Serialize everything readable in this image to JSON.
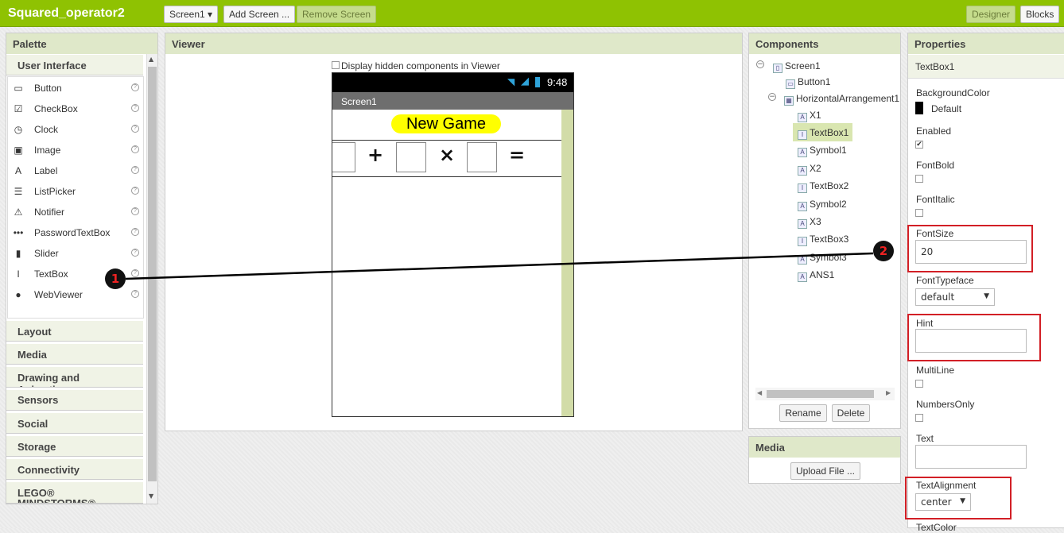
{
  "app": {
    "title": "Squared_operator2"
  },
  "toolbar": {
    "screen_select": "Screen1 ▾",
    "add_screen": "Add Screen ...",
    "remove_screen": "Remove Screen",
    "designer": "Designer",
    "blocks": "Blocks"
  },
  "palette": {
    "title": "Palette",
    "category": "User Interface",
    "items": [
      {
        "label": "Button",
        "icon": "button-icon"
      },
      {
        "label": "CheckBox",
        "icon": "checkbox-icon"
      },
      {
        "label": "Clock",
        "icon": "clock-icon"
      },
      {
        "label": "Image",
        "icon": "image-icon"
      },
      {
        "label": "Label",
        "icon": "label-icon"
      },
      {
        "label": "ListPicker",
        "icon": "listpicker-icon"
      },
      {
        "label": "Notifier",
        "icon": "notifier-icon"
      },
      {
        "label": "PasswordTextBox",
        "icon": "password-icon"
      },
      {
        "label": "Slider",
        "icon": "slider-icon"
      },
      {
        "label": "TextBox",
        "icon": "textbox-icon"
      },
      {
        "label": "WebViewer",
        "icon": "webviewer-icon"
      }
    ],
    "categories": [
      "Layout",
      "Media",
      "Drawing and Animation",
      "Sensors",
      "Social",
      "Storage",
      "Connectivity",
      "LEGO® MINDSTORMS®"
    ]
  },
  "viewer": {
    "title": "Viewer",
    "hidden_label": "Display hidden components in Viewer",
    "time": "9:48",
    "screen_title": "Screen1",
    "new_game": "New Game",
    "plus": "+",
    "times": "×",
    "equals": "="
  },
  "components": {
    "title": "Components",
    "tree": [
      {
        "label": "Screen1",
        "icon": "screen-icon"
      },
      {
        "label": "Button1",
        "icon": "button-icon"
      },
      {
        "label": "HorizontalArrangement1",
        "icon": "arrangement-icon"
      },
      {
        "label": "X1",
        "icon": "label-icon"
      },
      {
        "label": "TextBox1",
        "icon": "textbox-icon"
      },
      {
        "label": "Symbol1",
        "icon": "label-icon"
      },
      {
        "label": "X2",
        "icon": "label-icon"
      },
      {
        "label": "TextBox2",
        "icon": "textbox-icon"
      },
      {
        "label": "Symbol2",
        "icon": "label-icon"
      },
      {
        "label": "X3",
        "icon": "label-icon"
      },
      {
        "label": "TextBox3",
        "icon": "textbox-icon"
      },
      {
        "label": "Symbol3",
        "icon": "label-icon"
      },
      {
        "label": "ANS1",
        "icon": "label-icon"
      }
    ],
    "rename": "Rename",
    "delete": "Delete"
  },
  "media": {
    "title": "Media",
    "upload": "Upload File ..."
  },
  "properties": {
    "title": "Properties",
    "component": "TextBox1",
    "background_color_label": "BackgroundColor",
    "background_color_value": "Default",
    "enabled_label": "Enabled",
    "enabled": true,
    "fontbold_label": "FontBold",
    "fontitalic_label": "FontItalic",
    "fontsize_label": "FontSize",
    "fontsize_value": "20",
    "fonttypeface_label": "FontTypeface",
    "fonttypeface_value": "default",
    "hint_label": "Hint",
    "hint_value": "",
    "multiline_label": "MultiLine",
    "numbersonly_label": "NumbersOnly",
    "text_label": "Text",
    "text_value": "",
    "textalignment_label": "TextAlignment",
    "textalignment_value": "center",
    "textcolor_label": "TextColor"
  },
  "annotations": {
    "marker1": "1",
    "marker2": "2"
  },
  "colors": {
    "topbar": "#8fc202",
    "accent_red": "#d21f26",
    "panel_header": "#dfe8c9",
    "new_game_bg": "#ffff00"
  }
}
